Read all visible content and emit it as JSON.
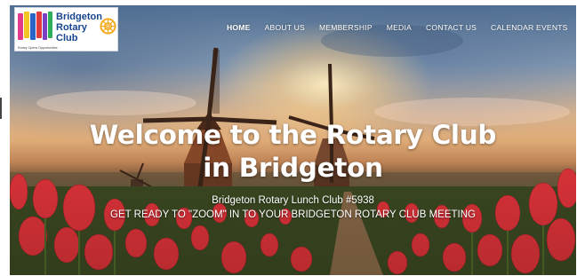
{
  "logo": {
    "line1": "Bridgeton",
    "line2": "Rotary",
    "line3": "Club",
    "tagline": "Rotary Opens Opportunities",
    "flag_colors": [
      "#e23b8a",
      "#f3c623",
      "#2a66c8",
      "#e23b3b",
      "#7a3fc2",
      "#2fae5b"
    ],
    "wheel_color": "#f7a81b"
  },
  "nav": {
    "items": [
      {
        "label": "HOME",
        "active": true
      },
      {
        "label": "ABOUT US",
        "active": false
      },
      {
        "label": "MEMBERSHIP",
        "active": false
      },
      {
        "label": "MEDIA",
        "active": false
      },
      {
        "label": "CONTACT US",
        "active": false
      },
      {
        "label": "CALENDAR EVENTS",
        "active": false
      }
    ]
  },
  "hero": {
    "title_line1": "Welcome to the Rotary Club",
    "title_line2": "in Bridgeton",
    "subtitle": "Bridgeton Rotary Lunch Club #5938",
    "cta_text": "GET READY TO \"ZOOM\" IN TO YOUR BRIDGETON ROTARY CLUB MEETING"
  },
  "colors": {
    "brand_blue": "#17458f",
    "tulip_red": "#e0343a",
    "sky_blue": "#5a7ea8"
  }
}
